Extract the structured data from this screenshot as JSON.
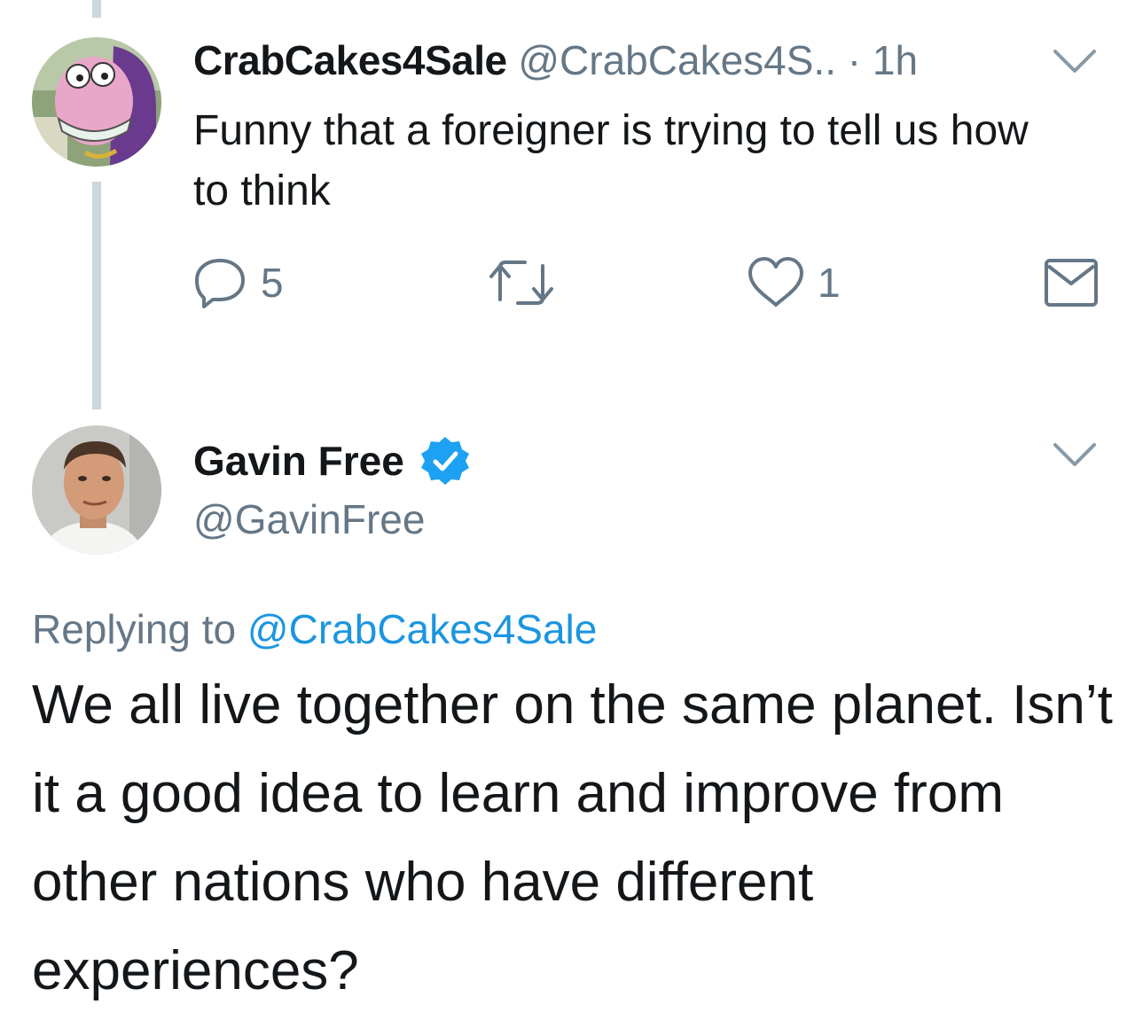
{
  "tweet1": {
    "display_name": "CrabCakes4Sale",
    "handle": "@CrabCakes4S..",
    "separator": "·",
    "time": "1h",
    "text": "Funny that a foreigner is trying to tell us how to think",
    "reply_count": "5",
    "retweet_count": "",
    "like_count": "1",
    "avatar_icon": "cartoon-avatar",
    "icons": [
      "chevron-down-icon",
      "reply-icon",
      "retweet-icon",
      "like-icon",
      "direct-message-icon"
    ]
  },
  "tweet2": {
    "display_name": "Gavin Free",
    "verified": true,
    "handle": "@GavinFree",
    "replying_prefix": "Replying to",
    "replying_to": "@CrabCakes4Sale",
    "text": "We all live together on the same planet. Isn’t it a good idea to learn and improve from other nations who have different experiences?",
    "avatar_icon": "photo-avatar"
  },
  "colors": {
    "text": "#14171a",
    "secondary": "#657786",
    "link": "#1b95e0",
    "verified": "#1da1f2",
    "thread_line": "#ccd6dd"
  }
}
